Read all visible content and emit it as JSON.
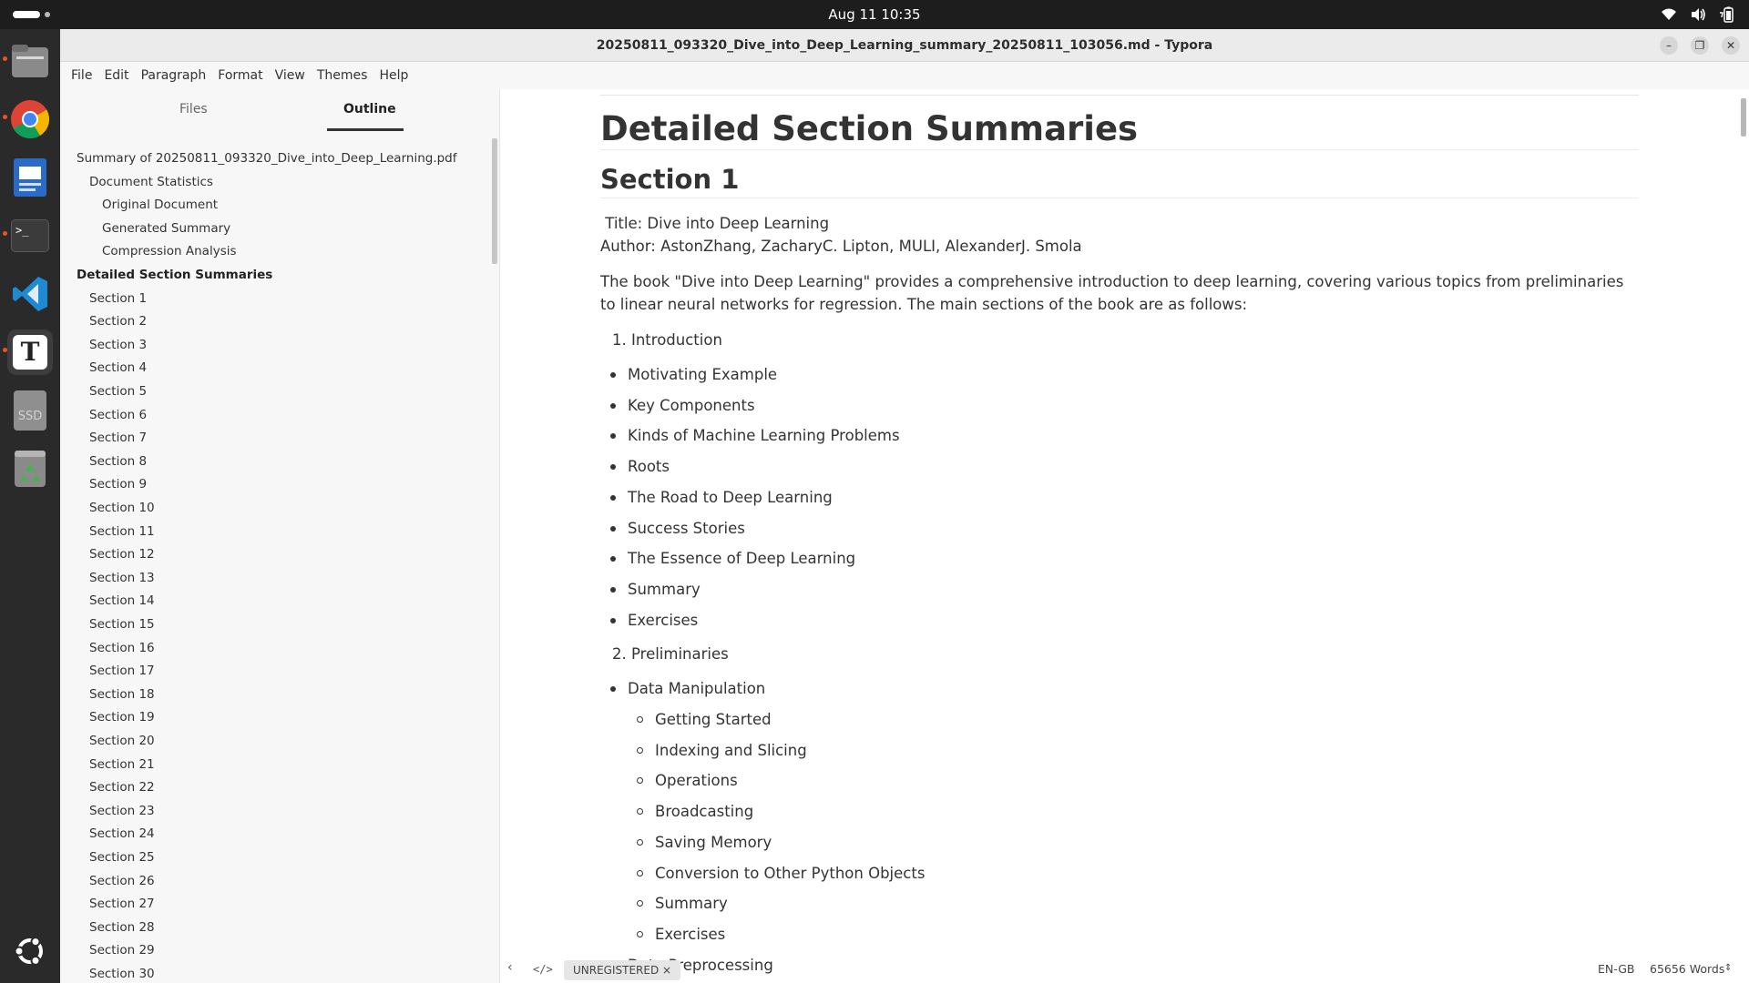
{
  "topbar": {
    "clock": "Aug 11  10:35"
  },
  "dock": {
    "items": [
      {
        "icon": "files-icon",
        "color": "#8e8e8e"
      },
      {
        "icon": "chrome-icon",
        "color": "#4285f4"
      },
      {
        "icon": "writer-icon",
        "color": "#2a6bc7"
      },
      {
        "icon": "terminal-icon",
        "color": "#3b3b3b"
      },
      {
        "icon": "vscode-icon",
        "color": "#1f8ad2"
      },
      {
        "icon": "typora-icon",
        "color": "#ffffff"
      },
      {
        "icon": "ssd-drive-icon",
        "color": "#9a9a9a"
      },
      {
        "icon": "trash-icon",
        "color": "#4caf50"
      },
      {
        "icon": "ubuntu-apps-icon",
        "color": "#ffffff"
      }
    ],
    "ssd_label": "SSD",
    "terminal_label": ">_",
    "typora_label": "T"
  },
  "window": {
    "title": "20250811_093320_Dive_into_Deep_Learning_summary_20250811_103056.md - Typora",
    "minimize": "–",
    "maximize": "❐",
    "close": "✕"
  },
  "menu": [
    "File",
    "Edit",
    "Paragraph",
    "Format",
    "View",
    "Themes",
    "Help"
  ],
  "sidebar": {
    "tabs": {
      "files": "Files",
      "outline": "Outline"
    },
    "outline": [
      {
        "label": "Summary of 20250811_093320_Dive_into_Deep_Learning.pdf",
        "level": 1
      },
      {
        "label": "Document Statistics",
        "level": 2
      },
      {
        "label": "Original Document",
        "level": 3
      },
      {
        "label": "Generated Summary",
        "level": 3
      },
      {
        "label": "Compression Analysis",
        "level": 3
      },
      {
        "label": "Detailed Section Summaries",
        "level": 1,
        "bold": true
      },
      {
        "label": "Section 1",
        "level": 2
      },
      {
        "label": "Section 2",
        "level": 2
      },
      {
        "label": "Section 3",
        "level": 2
      },
      {
        "label": "Section 4",
        "level": 2
      },
      {
        "label": "Section 5",
        "level": 2
      },
      {
        "label": "Section 6",
        "level": 2
      },
      {
        "label": "Section 7",
        "level": 2
      },
      {
        "label": "Section 8",
        "level": 2
      },
      {
        "label": "Section 9",
        "level": 2
      },
      {
        "label": "Section 10",
        "level": 2
      },
      {
        "label": "Section 11",
        "level": 2
      },
      {
        "label": "Section 12",
        "level": 2
      },
      {
        "label": "Section 13",
        "level": 2
      },
      {
        "label": "Section 14",
        "level": 2
      },
      {
        "label": "Section 15",
        "level": 2
      },
      {
        "label": "Section 16",
        "level": 2
      },
      {
        "label": "Section 17",
        "level": 2
      },
      {
        "label": "Section 18",
        "level": 2
      },
      {
        "label": "Section 19",
        "level": 2
      },
      {
        "label": "Section 20",
        "level": 2
      },
      {
        "label": "Section 21",
        "level": 2
      },
      {
        "label": "Section 22",
        "level": 2
      },
      {
        "label": "Section 23",
        "level": 2
      },
      {
        "label": "Section 24",
        "level": 2
      },
      {
        "label": "Section 25",
        "level": 2
      },
      {
        "label": "Section 26",
        "level": 2
      },
      {
        "label": "Section 27",
        "level": 2
      },
      {
        "label": "Section 28",
        "level": 2
      },
      {
        "label": "Section 29",
        "level": 2
      },
      {
        "label": "Section 30",
        "level": 2
      }
    ]
  },
  "doc": {
    "h1": "Detailed Section Summaries",
    "h2": "Section 1",
    "title_line": " Title: Dive into Deep Learning",
    "author_line": "Author: AstonZhang, ZacharyC. Lipton, MULI, AlexanderJ. Smola",
    "intro": "The book \"Dive into Deep Learning\" provides a comprehensive introduction to deep learning, covering various topics from preliminaries to linear neural networks for regression. The main sections of the book are as follows:",
    "ordered1": "1. Introduction",
    "list1": [
      "Motivating Example",
      "Key Components",
      "Kinds of Machine Learning Problems",
      "Roots",
      "The Road to Deep Learning",
      "Success Stories",
      "The Essence of Deep Learning",
      "Summary",
      "Exercises"
    ],
    "ordered2": "2. Preliminaries",
    "list2_item": "Data Manipulation",
    "sublist": [
      "Getting Started",
      "Indexing and Slicing",
      "Operations",
      "Broadcasting",
      "Saving Memory",
      "Conversion to Other Python Objects",
      "Summary",
      "Exercises"
    ],
    "list2_next": "Data Preprocessing"
  },
  "status": {
    "back": "‹",
    "source": "</>",
    "badge": "UNREGISTERED ×",
    "language": "EN-GB",
    "words": "65656 Words"
  }
}
